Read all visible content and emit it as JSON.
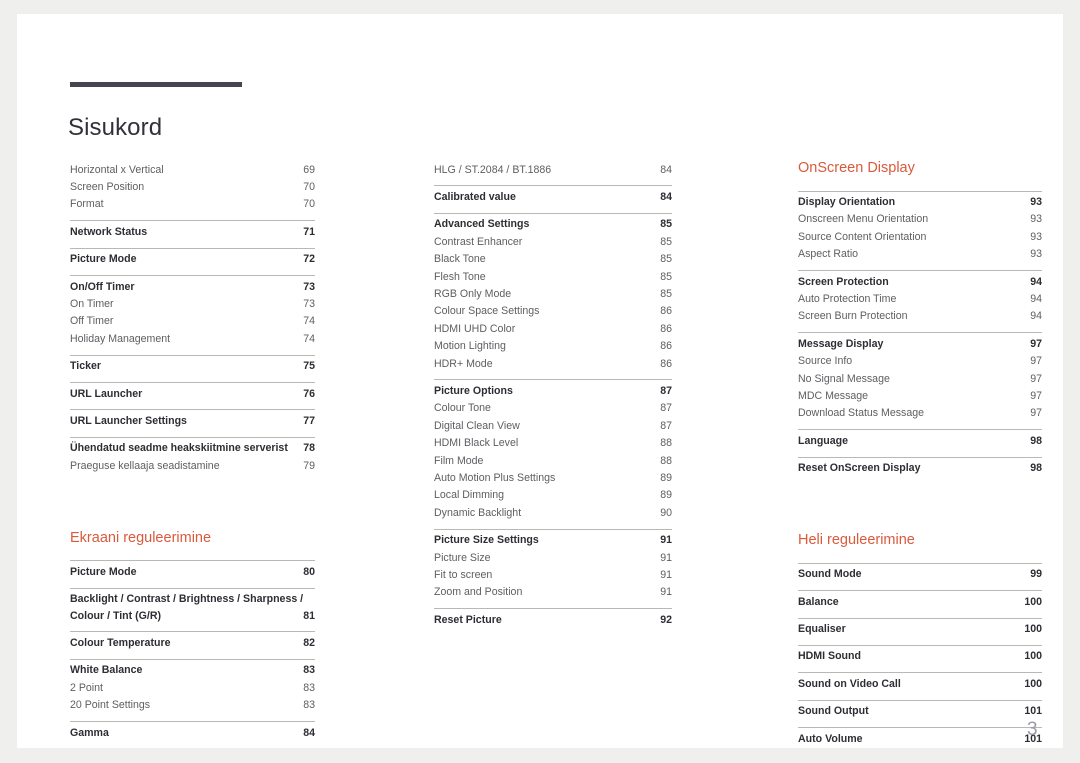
{
  "document": {
    "title": "Sisukord",
    "page_number": "3",
    "accent_color": "#da5a3b",
    "rule_color": "#474350"
  },
  "columns": [
    {
      "name": "left",
      "blocks": [
        {
          "type": "group",
          "rule": false,
          "rows": [
            {
              "label": "Horizontal x Vertical",
              "page": "69",
              "level": "sub"
            },
            {
              "label": "Screen Position",
              "page": "70",
              "level": "sub"
            },
            {
              "label": "Format",
              "page": "70",
              "level": "sub"
            }
          ]
        },
        {
          "type": "group",
          "rule": true,
          "rows": [
            {
              "label": "Network Status",
              "page": "71",
              "level": "main"
            }
          ]
        },
        {
          "type": "group",
          "rule": true,
          "rows": [
            {
              "label": "Picture Mode",
              "page": "72",
              "level": "main"
            }
          ]
        },
        {
          "type": "group",
          "rule": true,
          "rows": [
            {
              "label": "On/Off Timer",
              "page": "73",
              "level": "main"
            },
            {
              "label": "On Timer",
              "page": "73",
              "level": "sub"
            },
            {
              "label": "Off Timer",
              "page": "74",
              "level": "sub"
            },
            {
              "label": "Holiday Management",
              "page": "74",
              "level": "sub"
            }
          ]
        },
        {
          "type": "group",
          "rule": true,
          "rows": [
            {
              "label": "Ticker",
              "page": "75",
              "level": "main"
            }
          ]
        },
        {
          "type": "group",
          "rule": true,
          "rows": [
            {
              "label": "URL Launcher",
              "page": "76",
              "level": "main"
            }
          ]
        },
        {
          "type": "group",
          "rule": true,
          "rows": [
            {
              "label": "URL Launcher Settings",
              "page": "77",
              "level": "main"
            }
          ]
        },
        {
          "type": "group",
          "rule": true,
          "rows": [
            {
              "label": "Ühendatud seadme heakskiitmine serverist",
              "page": "78",
              "level": "main"
            },
            {
              "label": "Praeguse kellaaja seadistamine",
              "page": "79",
              "level": "sub"
            }
          ]
        },
        {
          "type": "heading",
          "label": "Ekraani reguleerimine"
        },
        {
          "type": "group",
          "rule": true,
          "rows": [
            {
              "label": "Picture Mode",
              "page": "80",
              "level": "main"
            }
          ]
        },
        {
          "type": "group",
          "rule": true,
          "rows": [
            {
              "label": "Backlight / Contrast / Brightness / Sharpness / Colour / Tint (G/R)",
              "page": "81",
              "level": "main",
              "wrap": true
            }
          ]
        },
        {
          "type": "group",
          "rule": true,
          "rows": [
            {
              "label": "Colour Temperature",
              "page": "82",
              "level": "main"
            }
          ]
        },
        {
          "type": "group",
          "rule": true,
          "rows": [
            {
              "label": "White Balance",
              "page": "83",
              "level": "main"
            },
            {
              "label": "2 Point",
              "page": "83",
              "level": "sub"
            },
            {
              "label": "20 Point Settings",
              "page": "83",
              "level": "sub"
            }
          ]
        },
        {
          "type": "group",
          "rule": true,
          "rows": [
            {
              "label": "Gamma",
              "page": "84",
              "level": "main"
            }
          ]
        }
      ]
    },
    {
      "name": "middle",
      "blocks": [
        {
          "type": "group",
          "rule": false,
          "rows": [
            {
              "label": "HLG / ST.2084 / BT.1886",
              "page": "84",
              "level": "sub"
            }
          ]
        },
        {
          "type": "group",
          "rule": true,
          "rows": [
            {
              "label": "Calibrated value",
              "page": "84",
              "level": "main"
            }
          ]
        },
        {
          "type": "group",
          "rule": true,
          "rows": [
            {
              "label": "Advanced Settings",
              "page": "85",
              "level": "main"
            },
            {
              "label": "Contrast Enhancer",
              "page": "85",
              "level": "sub"
            },
            {
              "label": "Black Tone",
              "page": "85",
              "level": "sub"
            },
            {
              "label": "Flesh Tone",
              "page": "85",
              "level": "sub"
            },
            {
              "label": "RGB Only Mode",
              "page": "85",
              "level": "sub"
            },
            {
              "label": "Colour Space Settings",
              "page": "86",
              "level": "sub"
            },
            {
              "label": "HDMI UHD Color",
              "page": "86",
              "level": "sub"
            },
            {
              "label": "Motion Lighting",
              "page": "86",
              "level": "sub"
            },
            {
              "label": "HDR+ Mode",
              "page": "86",
              "level": "sub"
            }
          ]
        },
        {
          "type": "group",
          "rule": true,
          "rows": [
            {
              "label": "Picture Options",
              "page": "87",
              "level": "main"
            },
            {
              "label": "Colour Tone",
              "page": "87",
              "level": "sub"
            },
            {
              "label": "Digital Clean View",
              "page": "87",
              "level": "sub"
            },
            {
              "label": "HDMI Black Level",
              "page": "88",
              "level": "sub"
            },
            {
              "label": "Film Mode",
              "page": "88",
              "level": "sub"
            },
            {
              "label": "Auto Motion Plus Settings",
              "page": "89",
              "level": "sub"
            },
            {
              "label": "Local Dimming",
              "page": "89",
              "level": "sub"
            },
            {
              "label": "Dynamic Backlight",
              "page": "90",
              "level": "sub"
            }
          ]
        },
        {
          "type": "group",
          "rule": true,
          "rows": [
            {
              "label": "Picture Size Settings",
              "page": "91",
              "level": "main"
            },
            {
              "label": "Picture Size",
              "page": "91",
              "level": "sub"
            },
            {
              "label": "Fit to screen",
              "page": "91",
              "level": "sub"
            },
            {
              "label": "Zoom and Position",
              "page": "91",
              "level": "sub"
            }
          ]
        },
        {
          "type": "group",
          "rule": true,
          "rows": [
            {
              "label": "Reset Picture",
              "page": "92",
              "level": "main"
            }
          ]
        }
      ]
    },
    {
      "name": "right",
      "blocks": [
        {
          "type": "heading-first",
          "label": "OnScreen Display"
        },
        {
          "type": "group",
          "rule": true,
          "rows": [
            {
              "label": "Display Orientation",
              "page": "93",
              "level": "main"
            },
            {
              "label": "Onscreen Menu Orientation",
              "page": "93",
              "level": "sub"
            },
            {
              "label": "Source Content Orientation",
              "page": "93",
              "level": "sub"
            },
            {
              "label": "Aspect Ratio",
              "page": "93",
              "level": "sub"
            }
          ]
        },
        {
          "type": "group",
          "rule": true,
          "rows": [
            {
              "label": "Screen Protection",
              "page": "94",
              "level": "main"
            },
            {
              "label": "Auto Protection Time",
              "page": "94",
              "level": "sub"
            },
            {
              "label": "Screen Burn Protection",
              "page": "94",
              "level": "sub"
            }
          ]
        },
        {
          "type": "group",
          "rule": true,
          "rows": [
            {
              "label": "Message Display",
              "page": "97",
              "level": "main"
            },
            {
              "label": "Source Info",
              "page": "97",
              "level": "sub"
            },
            {
              "label": "No Signal Message",
              "page": "97",
              "level": "sub"
            },
            {
              "label": "MDC Message",
              "page": "97",
              "level": "sub"
            },
            {
              "label": "Download Status Message",
              "page": "97",
              "level": "sub"
            }
          ]
        },
        {
          "type": "group",
          "rule": true,
          "rows": [
            {
              "label": "Language",
              "page": "98",
              "level": "main"
            }
          ]
        },
        {
          "type": "group",
          "rule": true,
          "rows": [
            {
              "label": "Reset OnScreen Display",
              "page": "98",
              "level": "main"
            }
          ]
        },
        {
          "type": "heading",
          "label": "Heli reguleerimine"
        },
        {
          "type": "group",
          "rule": true,
          "rows": [
            {
              "label": "Sound Mode",
              "page": "99",
              "level": "main"
            }
          ]
        },
        {
          "type": "group",
          "rule": true,
          "rows": [
            {
              "label": "Balance",
              "page": "100",
              "level": "main"
            }
          ]
        },
        {
          "type": "group",
          "rule": true,
          "rows": [
            {
              "label": "Equaliser",
              "page": "100",
              "level": "main"
            }
          ]
        },
        {
          "type": "group",
          "rule": true,
          "rows": [
            {
              "label": "HDMI Sound",
              "page": "100",
              "level": "main"
            }
          ]
        },
        {
          "type": "group",
          "rule": true,
          "rows": [
            {
              "label": "Sound on Video Call",
              "page": "100",
              "level": "main"
            }
          ]
        },
        {
          "type": "group",
          "rule": true,
          "rows": [
            {
              "label": "Sound Output",
              "page": "101",
              "level": "main"
            }
          ]
        },
        {
          "type": "group",
          "rule": true,
          "rows": [
            {
              "label": "Auto Volume",
              "page": "101",
              "level": "main"
            }
          ]
        }
      ]
    }
  ]
}
